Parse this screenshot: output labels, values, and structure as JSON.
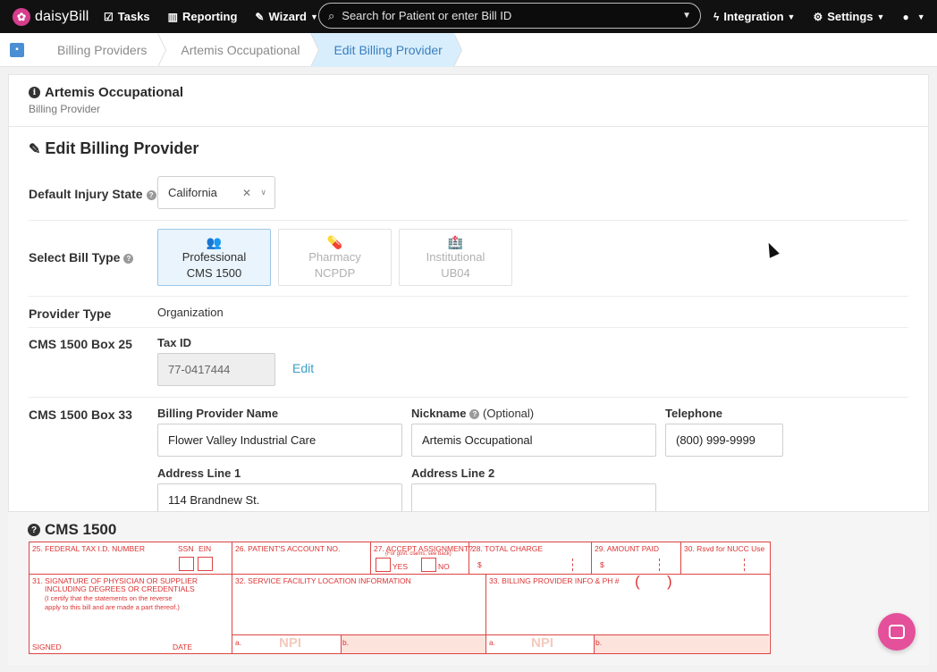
{
  "nav": {
    "brand": "daisyBill",
    "tasks": "Tasks",
    "reporting": "Reporting",
    "wizard": "Wizard",
    "search_placeholder": "Search for Patient or enter Bill ID",
    "integration": "Integration",
    "settings": "Settings",
    "user_icon": "user-circle-icon"
  },
  "breadcrumbs": [
    "Billing Providers",
    "Artemis Occupational",
    "Edit Billing Provider"
  ],
  "header": {
    "title": "Artemis Occupational",
    "subtitle": "Billing Provider"
  },
  "section_title": "Edit Billing Provider",
  "form": {
    "injury_state_label": "Default Injury State",
    "injury_state_value": "California",
    "bill_type_label": "Select Bill Type",
    "bill_types": [
      {
        "name": "Professional",
        "sub": "CMS 1500",
        "selected": true
      },
      {
        "name": "Pharmacy",
        "sub": "NCPDP",
        "selected": false
      },
      {
        "name": "Institutional",
        "sub": "UB04",
        "selected": false
      }
    ],
    "provider_type_label": "Provider Type",
    "provider_type_value": "Organization",
    "box25_label": "CMS 1500 Box 25",
    "tax_id_label": "Tax ID",
    "tax_id_value": "77-0417444",
    "edit_link": "Edit",
    "box33_label": "CMS 1500 Box 33",
    "billing_name_label": "Billing Provider Name",
    "billing_name_value": "Flower Valley Industrial Care",
    "nickname_label": "Nickname",
    "nickname_optional": "(Optional)",
    "nickname_value": "Artemis Occupational",
    "telephone_label": "Telephone",
    "telephone_value": "(800) 999-9999",
    "address1_label": "Address Line 1",
    "address1_value": "114 Brandnew St.",
    "address2_label": "Address Line 2",
    "address2_value": ""
  },
  "cms": {
    "title": "CMS 1500",
    "box25": "25. FEDERAL TAX I.D. NUMBER",
    "ssn": "SSN",
    "ein": "EIN",
    "box26": "26. PATIENT'S ACCOUNT NO.",
    "box27": "27. ACCEPT ASSIGNMENT?",
    "box27_note": "(For govt. claims, see back)",
    "yes": "YES",
    "no": "NO",
    "box28": "28. TOTAL CHARGE",
    "box29": "29. AMOUNT PAID",
    "box30": "30. Rsvd for NUCC Use",
    "dollar": "$",
    "box31_a": "31. SIGNATURE OF PHYSICIAN OR SUPPLIER",
    "box31_b": "INCLUDING DEGREES OR CREDENTIALS",
    "box31_c": "(I certify that the statements on the reverse",
    "box31_d": "apply to this bill and are made a part thereof.)",
    "signed": "SIGNED",
    "date": "DATE",
    "box32": "32. SERVICE FACILITY LOCATION INFORMATION",
    "box33": "33. BILLING PROVIDER INFO & PH #",
    "paren_open": "(",
    "paren_close": ")",
    "a": "a.",
    "b": "b.",
    "npi": "NPI"
  },
  "colors": {
    "accent": "#3c9fc6",
    "form_red": "#dd3333",
    "brand_pink": "#e4509a",
    "selected_bg": "#eaf4fc"
  }
}
